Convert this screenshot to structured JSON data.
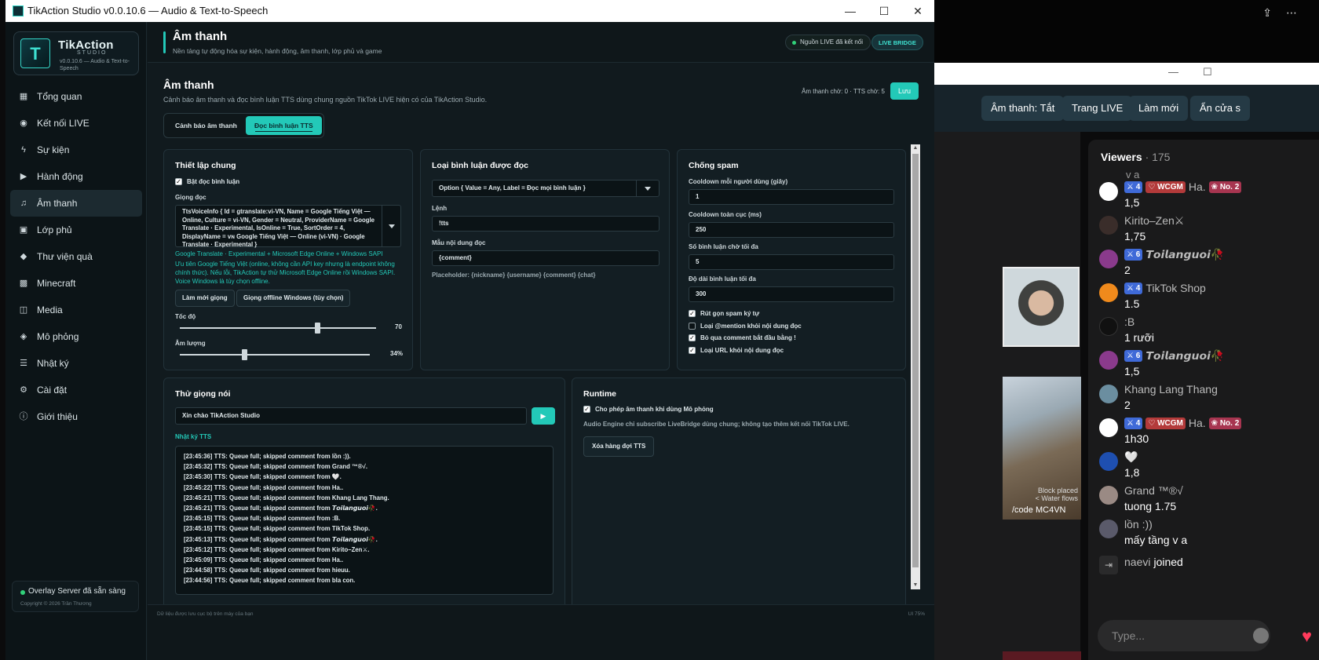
{
  "window": {
    "title": "TikAction Studio v0.0.10.6 — Audio & Text-to-Speech",
    "minimize": "—",
    "maximize": "☐",
    "close": "✕"
  },
  "brand": {
    "name": "TikAction",
    "studio": "STUDIO",
    "version": "v0.0.10.6 — Audio & Text-to-Speech",
    "mark": "T"
  },
  "sidebar": {
    "items": [
      {
        "label": "Tổng quan",
        "icon": "dashboard-icon",
        "glyph": "▦"
      },
      {
        "label": "Kết nối LIVE",
        "icon": "live-icon",
        "glyph": "◉"
      },
      {
        "label": "Sự kiện",
        "icon": "bolt-icon",
        "glyph": "ϟ"
      },
      {
        "label": "Hành động",
        "icon": "play-icon",
        "glyph": "▶"
      },
      {
        "label": "Âm thanh",
        "icon": "music-icon",
        "glyph": "♫"
      },
      {
        "label": "Lớp phủ",
        "icon": "layers-icon",
        "glyph": "▣"
      },
      {
        "label": "Thư viện quà",
        "icon": "gift-icon",
        "glyph": "◆"
      },
      {
        "label": "Minecraft",
        "icon": "cube-icon",
        "glyph": "▩"
      },
      {
        "label": "Media",
        "icon": "media-icon",
        "glyph": "◫"
      },
      {
        "label": "Mô phỏng",
        "icon": "simulate-icon",
        "glyph": "◈"
      },
      {
        "label": "Nhật ký",
        "icon": "log-icon",
        "glyph": "☰"
      },
      {
        "label": "Cài đặt",
        "icon": "gear-icon",
        "glyph": "⚙"
      },
      {
        "label": "Giới thiệu",
        "icon": "info-icon",
        "glyph": "ⓘ"
      }
    ],
    "overlay_status": "Overlay Server đã sẵn sàng",
    "copyright": "Copyright © 2026 Trần Thương"
  },
  "header": {
    "title": "Âm thanh",
    "subtitle": "Nền tảng tự động hóa sự kiện, hành động, âm thanh, lớp phủ và game",
    "live_status": "Nguồn LIVE đã kết nối",
    "live_bridge": "LIVE BRIDGE"
  },
  "page": {
    "title": "Âm thanh",
    "subtitle": "Cảnh báo âm thanh và đọc bình luận TTS dùng chung nguồn TikTok LIVE hiện có của TikAction Studio.",
    "queue": "Âm thanh chờ: 0 · TTS chờ: 5",
    "save": "Lưu",
    "tabs": [
      "Cảnh báo âm thanh",
      "Đọc bình luận TTS"
    ]
  },
  "general": {
    "title": "Thiết lập chung",
    "enable_read": "Bật đọc bình luận",
    "voice_label": "Giọng đọc",
    "voice_value": "TtsVoiceInfo { Id = gtranslate:vi-VN, Name = Google Tiếng Việt — Online, Culture = vi-VN, Gender = Neutral, ProviderName = Google Translate · Experimental, IsOnline = True, SortOrder = 4, DisplayName = ᴠɴ Google Tiếng Việt — Online (vi-VN) · Google Translate · Experimental }",
    "provider_line": "Google Translate · Experimental + Microsoft Edge Online + Windows SAPI",
    "priority_note": "Ưu tiên Google Tiếng Việt (online, không cần API key nhưng là endpoint không chính thức). Nếu lỗi, TikAction tự thử Microsoft Edge Online rồi Windows SAPI. Voice Windows là tùy chọn offline.",
    "refresh_voices": "Làm mới giọng",
    "offline_voices": "Giọng offline Windows (tùy chọn)",
    "speed_label": "Tốc độ",
    "speed_value": "70",
    "speed_fraction": 0.7,
    "volume_label": "Âm lượng",
    "volume_value": "34%",
    "volume_fraction": 0.34
  },
  "comment_type": {
    "title": "Loại bình luận được đọc",
    "option": "Option { Value = Any, Label = Đọc mọi bình luận }",
    "command_label": "Lệnh",
    "command_value": "!tts",
    "template_label": "Mẫu nội dung đọc",
    "template_value": "{comment}",
    "placeholder_note": "Placeholder: {nickname} {username} {comment} {chat}"
  },
  "antispam": {
    "title": "Chống spam",
    "cooldown_user_label": "Cooldown mỗi người dùng (giây)",
    "cooldown_user": "1",
    "cooldown_global_label": "Cooldown toàn cục (ms)",
    "cooldown_global": "250",
    "max_wait_label": "Số bình luận chờ tối đa",
    "max_wait": "5",
    "max_len_label": "Độ dài bình luận tối đa",
    "max_len": "300",
    "checks": [
      {
        "label": "Rút gọn spam ký tự",
        "checked": true
      },
      {
        "label": "Loại @mention khỏi nội dung đọc",
        "checked": false
      },
      {
        "label": "Bỏ qua comment bắt đầu bằng !",
        "checked": true
      },
      {
        "label": "Loại URL khỏi nội dung đọc",
        "checked": true
      }
    ]
  },
  "try_voice": {
    "title": "Thử giọng nói",
    "input": "Xin chào TikAction Studio",
    "play": "▶",
    "log_title": "Nhật ký TTS",
    "log": [
      "[23:45:36] TTS: Queue full; skipped comment from lồn :)).",
      "[23:45:32] TTS: Queue full; skipped comment from Grand ™®√.",
      "[23:45:30] TTS: Queue full; skipped comment from 🤍.",
      "[23:45:22] TTS: Queue full; skipped comment from Ha..",
      "[23:45:21] TTS: Queue full; skipped comment from Khang Lang Thang.",
      "[23:45:21] TTS: Queue full; skipped comment from 𝙏𝙤𝙞𝙡𝙖𝙣𝙜𝙪𝙤𝙞🥀.",
      "[23:45:15] TTS: Queue full; skipped comment from :B.",
      "[23:45:15] TTS: Queue full; skipped comment from TikTok Shop.",
      "[23:45:13] TTS: Queue full; skipped comment from 𝙏𝙤𝙞𝙡𝙖𝙣𝙜𝙪𝙤𝙞🥀.",
      "[23:45:12] TTS: Queue full; skipped comment from Kirito–Zen⚔.",
      "[23:45:09] TTS: Queue full; skipped comment from Ha..",
      "[23:44:58] TTS: Queue full; skipped comment from hieuu.",
      "[23:44:56] TTS: Queue full; skipped comment from bla con."
    ]
  },
  "runtime": {
    "title": "Runtime",
    "allow_sim": "Cho phép âm thanh khi dùng Mô phỏng",
    "note": "Audio Engine chỉ subscribe LiveBridge dùng chung; không tạo thêm kết nối TikTok LIVE.",
    "clear_queue": "Xóa hàng đợi TTS"
  },
  "footer": {
    "left": "Dữ liệu được lưu cục bộ trên máy của bạn",
    "right": "UI 75%"
  },
  "background": {
    "chips": [
      "Âm thanh: Tắt",
      "Trang LIVE",
      "Làm mới",
      "Ẩn cửa s"
    ],
    "video_caption": "/code MC4VN",
    "video_sub": "Block placed\n< Water flows",
    "chat": {
      "title": "Viewers",
      "count": "· 175",
      "partial": "v a",
      "placeholder": "Type...",
      "messages": [
        {
          "name": "Ha.",
          "text": "1,5",
          "level": "4",
          "fan": "WCGM",
          "rank": "No. 2",
          "color": "#ffffff"
        },
        {
          "name": "Kirito–Zen⚔",
          "text": "1,75",
          "color": "#3a2d2a"
        },
        {
          "name": "𝙏𝙤𝙞𝙡𝙖𝙣𝙜𝙪𝙤𝙞🥀",
          "text": "2",
          "level": "6",
          "color": "#8a3a8c"
        },
        {
          "name": "TikTok Shop",
          "text": "1.5",
          "level": "4",
          "color": "#f08a1c"
        },
        {
          "name": ":B",
          "text": "1 rưỡi",
          "color": "#111111"
        },
        {
          "name": "𝙏𝙤𝙞𝙡𝙖𝙣𝙜𝙪𝙤𝙞🥀",
          "text": "1,5",
          "level": "6",
          "color": "#8a3a8c"
        },
        {
          "name": "Khang Lang Thang",
          "text": "2",
          "color": "#6b8ea0"
        },
        {
          "name": "Ha.",
          "text": "1h30",
          "level": "4",
          "fan": "WCGM",
          "rank": "No. 2",
          "color": "#ffffff"
        },
        {
          "name": "🤍",
          "text": "1,8",
          "color": "#1e4fb0"
        },
        {
          "name": "Grand ™®√",
          "text": "tuong 1.75",
          "color": "#9a8a84"
        },
        {
          "name": "lồn :))",
          "text": "mấy tầng v a",
          "color": "#5a5a6a"
        }
      ],
      "joined_name": "naevi",
      "joined_text": "joined"
    }
  }
}
